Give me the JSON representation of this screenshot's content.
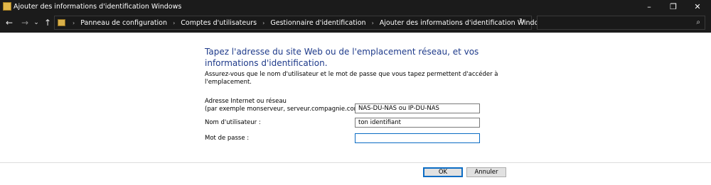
{
  "window": {
    "title": "Ajouter des informations d'identification Windows",
    "controls": {
      "minimize": "–",
      "maximize": "❐",
      "close": "✕"
    }
  },
  "nav": {
    "back": "←",
    "forward": "→",
    "recent": "⌄",
    "up": "↑"
  },
  "breadcrumb": {
    "items": [
      "Panneau de configuration",
      "Comptes d'utilisateurs",
      "Gestionnaire d'identification",
      "Ajouter des informations d'identification Windows"
    ],
    "separator": "›",
    "dropdown": "⌄",
    "refresh": "↻"
  },
  "search": {
    "placeholder": "",
    "icon": "⌕"
  },
  "content": {
    "heading": "Tapez l'adresse du site Web ou de l'emplacement réseau, et vos informations d'identification.",
    "description": "Assurez-vous que le nom d'utilisateur et le mot de passe que vous tapez permettent d'accéder à l'emplacement.",
    "address_label_line1": "Adresse Internet ou réseau",
    "address_label_line2": "(par exemple monserveur, serveur.compagnie.com) :",
    "address_value": "NAS-DU-NAS ou IP-DU-NAS",
    "username_label": "Nom d'utilisateur :",
    "username_value": "ton identifiant",
    "password_label": "Mot de passe :",
    "password_value": ""
  },
  "buttons": {
    "ok": "OK",
    "cancel": "Annuler"
  },
  "colors": {
    "heading": "#1e3a8a",
    "focus_border": "#0b6cc4",
    "title_bar": "#1b1b1b"
  }
}
